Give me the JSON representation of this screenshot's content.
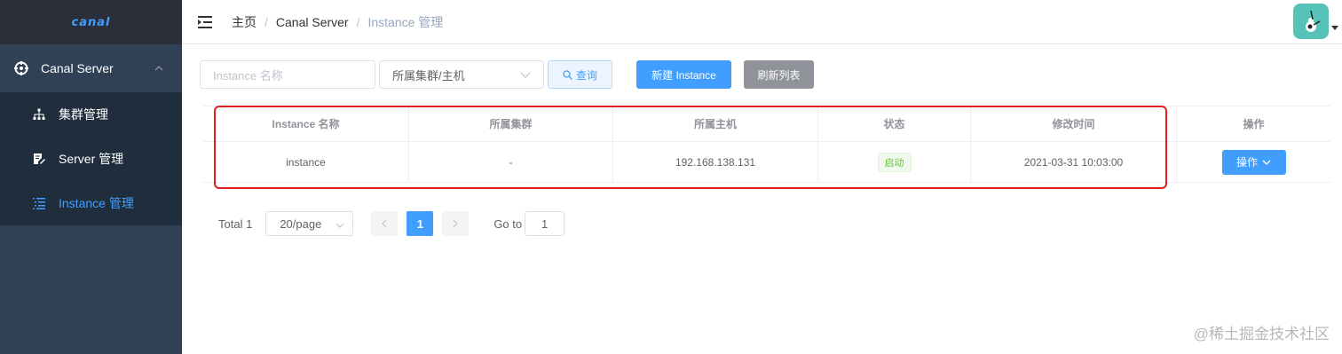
{
  "sidebar": {
    "logo": "canal",
    "menu": {
      "label": "Canal Server",
      "items": [
        {
          "label": "集群管理",
          "active": false
        },
        {
          "label": "Server 管理",
          "active": false
        },
        {
          "label": "Instance 管理",
          "active": true
        }
      ]
    }
  },
  "navbar": {
    "breadcrumb": [
      "主页",
      "Canal Server",
      "Instance 管理"
    ],
    "separator": "/"
  },
  "filter": {
    "name_placeholder": "Instance 名称",
    "cluster_select": "所属集群/主机",
    "query_label": "查询",
    "new_label": "新建 Instance",
    "refresh_label": "刷新列表"
  },
  "table": {
    "headers": [
      "Instance 名称",
      "所属集群",
      "所属主机",
      "状态",
      "修改时间",
      "操作"
    ],
    "rows": [
      {
        "name": "instance",
        "cluster": "-",
        "host": "192.168.138.131",
        "status": "启动",
        "modified": "2021-03-31 10:03:00",
        "action": "操作"
      }
    ]
  },
  "pagination": {
    "total": "Total 1",
    "page_size": "20/page",
    "current_page": "1",
    "goto_label": "Go to",
    "goto_value": "1"
  },
  "watermark": "@稀土掘金技术社区",
  "colors": {
    "sidebar_bg": "#304156",
    "primary": "#409eff",
    "success": "#67c23a",
    "highlight": "#e02020"
  }
}
